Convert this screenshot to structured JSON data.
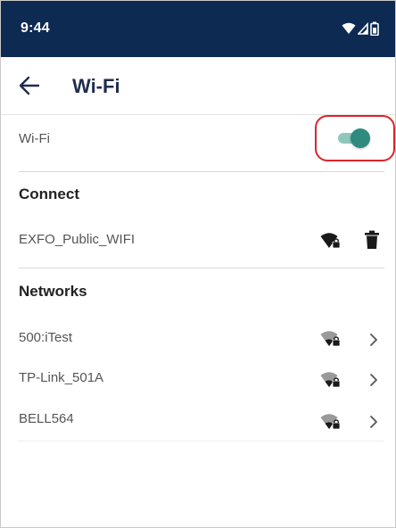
{
  "status_bar": {
    "time": "9:44",
    "icons": [
      "wifi-signal-icon",
      "cell-signal-icon",
      "battery-icon"
    ],
    "background_color": "#0c2a52"
  },
  "app_bar": {
    "title": "Wi-Fi",
    "back_icon": "arrow-left-icon"
  },
  "wifi_toggle": {
    "label": "Wi-Fi",
    "state": "on",
    "accent_color": "#2e8b7e",
    "highlight_color": "#d9262c"
  },
  "connect_section": {
    "title": "Connect",
    "items": [
      {
        "name": "EXFO_Public_WIFI",
        "icons": [
          "wifi-lock-icon",
          "trash-icon"
        ]
      }
    ]
  },
  "networks_section": {
    "title": "Networks",
    "items": [
      {
        "name": "500:iTest",
        "icons": [
          "wifi-lock-icon",
          "chevron-right-icon"
        ]
      },
      {
        "name": "TP-Link_501A",
        "icons": [
          "wifi-lock-icon",
          "chevron-right-icon"
        ]
      },
      {
        "name": "BELL564",
        "icons": [
          "wifi-lock-icon",
          "chevron-right-icon"
        ]
      }
    ]
  }
}
